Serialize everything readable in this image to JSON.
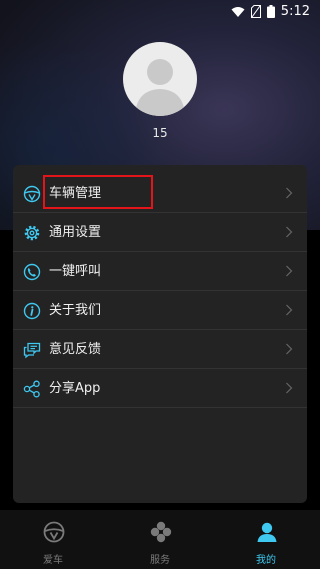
{
  "statusbar": {
    "time": "5:12"
  },
  "profile": {
    "username": "15"
  },
  "menu": {
    "items": [
      {
        "label": "车辆管理",
        "icon": "steering-wheel-icon"
      },
      {
        "label": "通用设置",
        "icon": "gear-icon"
      },
      {
        "label": "一键呼叫",
        "icon": "phone-icon"
      },
      {
        "label": "关于我们",
        "icon": "info-icon"
      },
      {
        "label": "意见反馈",
        "icon": "feedback-icon"
      },
      {
        "label": "分享App",
        "icon": "share-icon"
      }
    ]
  },
  "tabbar": {
    "tabs": [
      {
        "label": "爱车",
        "icon": "steering-wheel-icon",
        "active": false
      },
      {
        "label": "服务",
        "icon": "service-icon",
        "active": false
      },
      {
        "label": "我的",
        "icon": "person-icon",
        "active": true
      }
    ]
  },
  "colors": {
    "accent": "#3fc8f0",
    "highlight": "#e4141b",
    "card": "#232323"
  }
}
